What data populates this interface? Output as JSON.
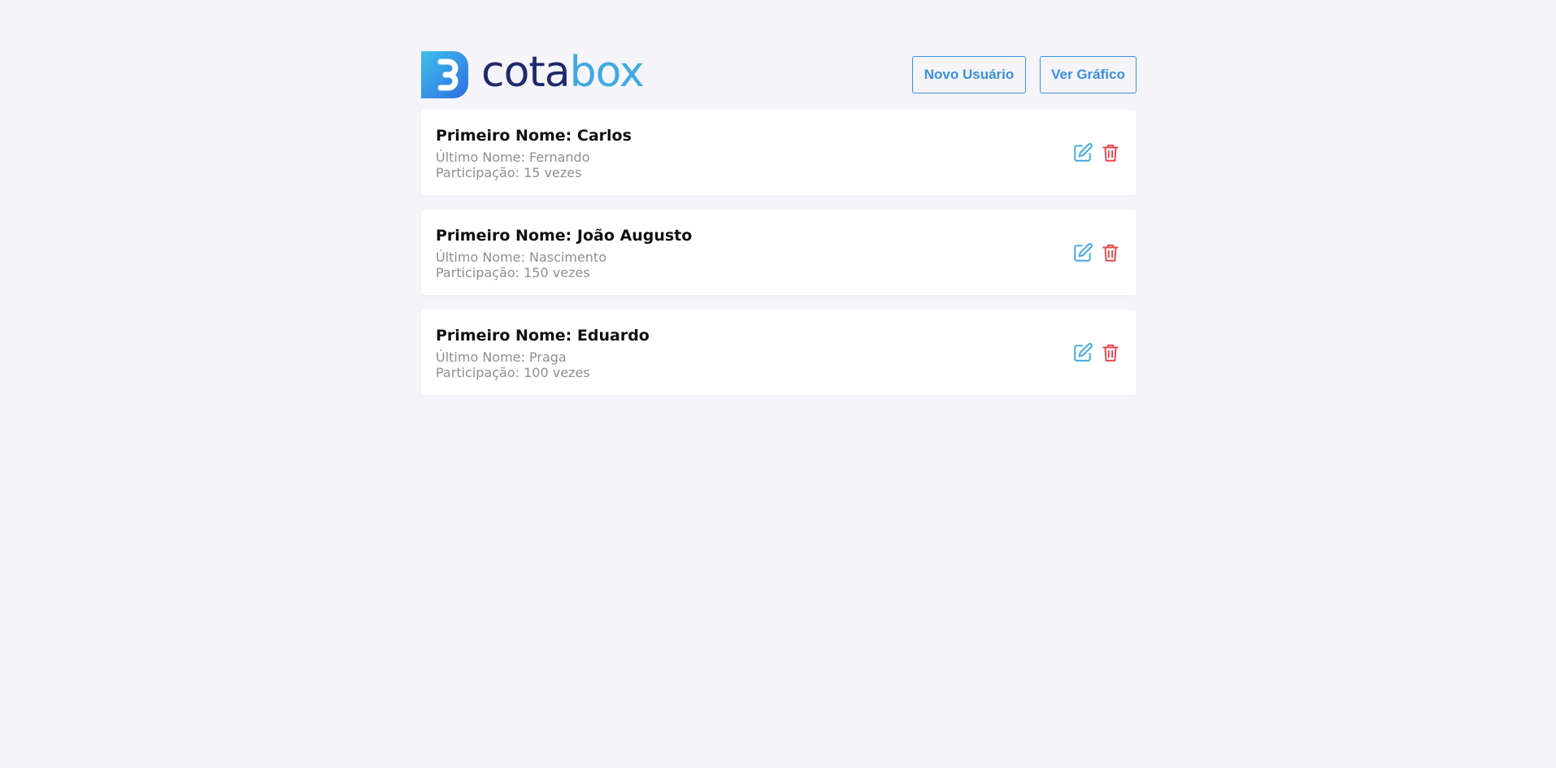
{
  "brand": {
    "logo_text_part1": "cota",
    "logo_text_part2": "box",
    "dark_color": "#1f2a6b",
    "light_color": "#3fa9e0"
  },
  "header": {
    "new_user_label": "Novo Usuário",
    "view_chart_label": "Ver Gráfico"
  },
  "users": [
    {
      "first_name": "Primeiro Nome: Carlos",
      "last_name": "Último Nome: Fernando",
      "participation": "Participação: 15 vezes"
    },
    {
      "first_name": "Primeiro Nome: João Augusto",
      "last_name": "Último Nome: Nascimento",
      "participation": "Participação: 150 vezes"
    },
    {
      "first_name": "Primeiro Nome: Eduardo",
      "last_name": "Último Nome: Praga",
      "participation": "Participação: 100 vezes"
    }
  ],
  "icons": {
    "edit": "edit-icon",
    "delete": "trash-icon",
    "edit_color": "#3fa9e0",
    "delete_color": "#e5484d"
  }
}
